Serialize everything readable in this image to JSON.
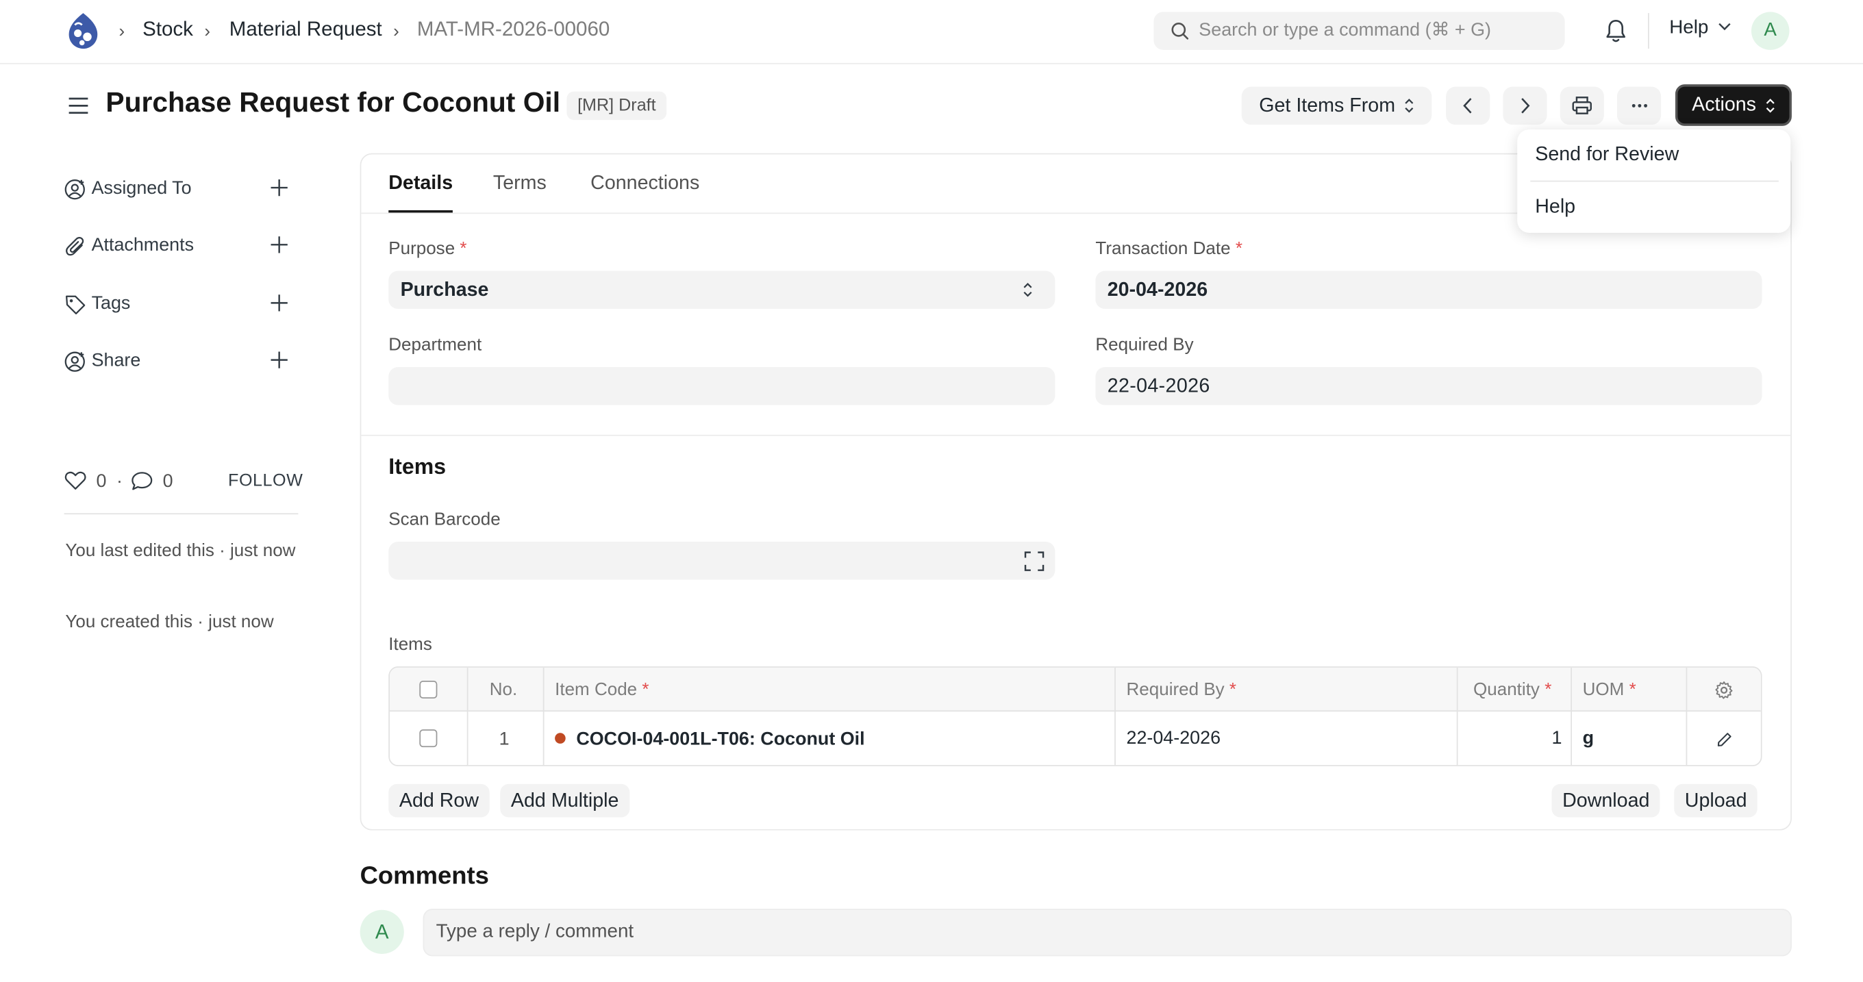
{
  "breadcrumbs": [
    "Stock",
    "Material Request",
    "MAT-MR-2026-00060"
  ],
  "search": {
    "placeholder": "Search or type a command (⌘ + G)"
  },
  "navbar": {
    "help_label": "Help",
    "avatar_initial": "A"
  },
  "page": {
    "title": "Purchase Request for Coconut Oil",
    "status": "[MR] Draft"
  },
  "toolbar": {
    "get_items_label": "Get Items From",
    "actions_label": "Actions"
  },
  "actions_menu": [
    "Send for Review",
    "Help"
  ],
  "sidebar": {
    "items": [
      {
        "label": "Assigned To",
        "icon": "user-plus-icon"
      },
      {
        "label": "Attachments",
        "icon": "paperclip-icon"
      },
      {
        "label": "Tags",
        "icon": "tag-icon"
      },
      {
        "label": "Share",
        "icon": "share-user-icon"
      }
    ],
    "likes": "0",
    "comments": "0",
    "follow_label": "FOLLOW",
    "last_edited": "You last edited this · just now",
    "created": "You created this · just now"
  },
  "tabs": [
    "Details",
    "Terms",
    "Connections"
  ],
  "form": {
    "purpose_label": "Purpose",
    "purpose_value": "Purchase",
    "transaction_date_label": "Transaction Date",
    "transaction_date_value": "20-04-2026",
    "department_label": "Department",
    "department_value": "",
    "required_by_label": "Required By",
    "required_by_value": "22-04-2026"
  },
  "items_section": {
    "heading": "Items",
    "scan_barcode_label": "Scan Barcode",
    "table_label": "Items",
    "columns": {
      "no": "No.",
      "item_code": "Item Code",
      "required_by": "Required By",
      "quantity": "Quantity",
      "uom": "UOM"
    },
    "rows": [
      {
        "no": "1",
        "item_code": "COCOI-04-001L-T06: Coconut Oil",
        "required_by": "22-04-2026",
        "quantity": "1",
        "uom": "g"
      }
    ],
    "add_row_label": "Add Row",
    "add_multiple_label": "Add Multiple",
    "download_label": "Download",
    "upload_label": "Upload"
  },
  "comments": {
    "title": "Comments",
    "avatar_initial": "A",
    "placeholder": "Type a reply / comment"
  },
  "colors": {
    "accent_dark": "#171717",
    "required": "#e24c4c",
    "item_dot": "#c04a23",
    "avatar_bg": "#e4f5e9",
    "avatar_fg": "#2f8a4e"
  }
}
